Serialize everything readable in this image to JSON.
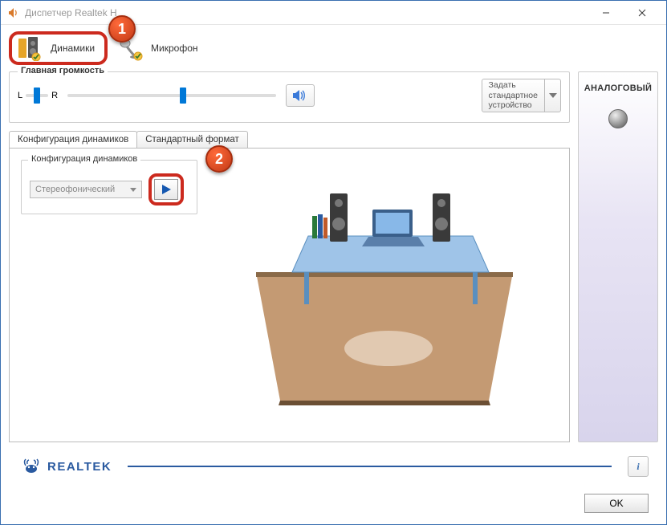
{
  "window": {
    "title": "Диспетчер Realtek H"
  },
  "annotations": {
    "badge1": "1",
    "badge2": "2"
  },
  "device_tabs": {
    "speakers": {
      "label": "Динамики"
    },
    "microphone": {
      "label": "Микрофон"
    }
  },
  "volume": {
    "group_label": "Главная громкость",
    "left": "L",
    "right": "R",
    "default_button": "Задать\nстандартное\nустройство"
  },
  "sub_tabs": {
    "config": "Конфигурация динамиков",
    "format": "Стандартный формат"
  },
  "config": {
    "group_label": "Конфигурация динамиков",
    "mode": "Стереофонический"
  },
  "right_panel": {
    "label": "АНАЛОГОВЫЙ"
  },
  "footer": {
    "brand": "REALTEK",
    "ok": "OK"
  }
}
